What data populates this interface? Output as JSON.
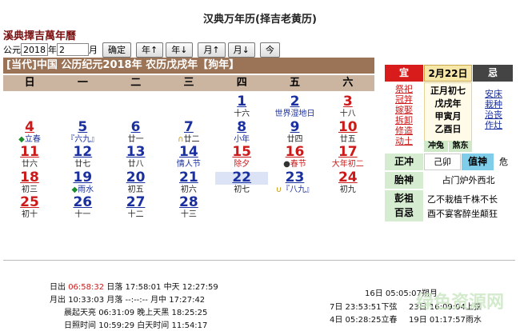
{
  "app_title": "汉典万年历(择吉老黄历)",
  "calendar_name": "溪典擇吉萬年曆",
  "controls": {
    "prefix": "公元",
    "year_value": "2018",
    "year_unit": "年",
    "month_value": "2",
    "month_unit": "月",
    "confirm": "确定",
    "year_up": "年↑",
    "year_down": "年↓",
    "month_up": "月↑",
    "month_down": "月↓",
    "today": "今"
  },
  "banner": {
    "era": "[当代]中国",
    "gregorian": "公历纪元2018年",
    "lunar": "农历戊戌年",
    "zodiac": "【狗年】"
  },
  "weekdays": [
    "日",
    "一",
    "二",
    "三",
    "四",
    "五",
    "六"
  ],
  "days": [
    {
      "day": "1",
      "sub": "十六",
      "col": 4,
      "row": 0,
      "dc": "blue",
      "sc": "dark",
      "mark": ""
    },
    {
      "day": "2",
      "sub": "世界湿地日",
      "col": 5,
      "row": 0,
      "dc": "blue",
      "sc": "blue",
      "mark": ""
    },
    {
      "day": "3",
      "sub": "十八",
      "col": 6,
      "row": 0,
      "dc": "red",
      "sc": "dark",
      "mark": ""
    },
    {
      "day": "4",
      "sub": "立春",
      "col": 0,
      "row": 1,
      "dc": "red",
      "sc": "blue",
      "mark": "◆"
    },
    {
      "day": "5",
      "sub": "『六九』",
      "col": 1,
      "row": 1,
      "dc": "blue",
      "sc": "blue",
      "mark": ""
    },
    {
      "day": "6",
      "sub": "廿一",
      "col": 2,
      "row": 1,
      "dc": "blue",
      "sc": "dark",
      "mark": ""
    },
    {
      "day": "7",
      "sub": "廿二",
      "col": 3,
      "row": 1,
      "dc": "blue",
      "sc": "dark",
      "mark": "∩"
    },
    {
      "day": "8",
      "sub": "小年",
      "col": 4,
      "row": 1,
      "dc": "blue",
      "sc": "blue",
      "mark": ""
    },
    {
      "day": "9",
      "sub": "廿四",
      "col": 5,
      "row": 1,
      "dc": "blue",
      "sc": "dark",
      "mark": ""
    },
    {
      "day": "10",
      "sub": "廿五",
      "col": 6,
      "row": 1,
      "dc": "red",
      "sc": "dark",
      "mark": ""
    },
    {
      "day": "11",
      "sub": "廿六",
      "col": 0,
      "row": 2,
      "dc": "red",
      "sc": "dark",
      "mark": ""
    },
    {
      "day": "12",
      "sub": "廿七",
      "col": 1,
      "row": 2,
      "dc": "blue",
      "sc": "dark",
      "mark": ""
    },
    {
      "day": "13",
      "sub": "廿八",
      "col": 2,
      "row": 2,
      "dc": "blue",
      "sc": "dark",
      "mark": ""
    },
    {
      "day": "14",
      "sub": "情人节",
      "col": 3,
      "row": 2,
      "dc": "blue",
      "sc": "blue",
      "mark": ""
    },
    {
      "day": "15",
      "sub": "除夕",
      "col": 4,
      "row": 2,
      "dc": "red",
      "sc": "red",
      "mark": ""
    },
    {
      "day": "16",
      "sub": "春节",
      "col": 5,
      "row": 2,
      "dc": "red",
      "sc": "red",
      "mark": "●"
    },
    {
      "day": "17",
      "sub": "大年初二",
      "col": 6,
      "row": 2,
      "dc": "red",
      "sc": "red",
      "mark": ""
    },
    {
      "day": "18",
      "sub": "初三",
      "col": 0,
      "row": 3,
      "dc": "red",
      "sc": "dark",
      "mark": ""
    },
    {
      "day": "19",
      "sub": "雨水",
      "col": 1,
      "row": 3,
      "dc": "blue",
      "sc": "blue",
      "mark": "◆"
    },
    {
      "day": "20",
      "sub": "初五",
      "col": 2,
      "row": 3,
      "dc": "blue",
      "sc": "dark",
      "mark": ""
    },
    {
      "day": "21",
      "sub": "初六",
      "col": 3,
      "row": 3,
      "dc": "blue",
      "sc": "dark",
      "mark": ""
    },
    {
      "day": "22",
      "sub": "初七",
      "col": 4,
      "row": 3,
      "dc": "blue",
      "sc": "dark",
      "mark": "",
      "today": true
    },
    {
      "day": "23",
      "sub": "『八九』",
      "col": 5,
      "row": 3,
      "dc": "blue",
      "sc": "blue",
      "mark": "∪"
    },
    {
      "day": "24",
      "sub": "初九",
      "col": 6,
      "row": 3,
      "dc": "red",
      "sc": "dark",
      "mark": ""
    },
    {
      "day": "25",
      "sub": "初十",
      "col": 0,
      "row": 4,
      "dc": "red",
      "sc": "dark",
      "mark": ""
    },
    {
      "day": "26",
      "sub": "十一",
      "col": 1,
      "row": 4,
      "dc": "blue",
      "sc": "dark",
      "mark": ""
    },
    {
      "day": "27",
      "sub": "十二",
      "col": 2,
      "row": 4,
      "dc": "blue",
      "sc": "dark",
      "mark": ""
    },
    {
      "day": "28",
      "sub": "十三",
      "col": 3,
      "row": 4,
      "dc": "blue",
      "sc": "dark",
      "mark": ""
    }
  ],
  "almanac": {
    "yi_label": "宜",
    "ji_label": "忌",
    "date_label": "2月22日",
    "yi_items": [
      "祭祀",
      "冠笄",
      "嫁娶",
      "拆卸",
      "修造",
      "动土"
    ],
    "ji_items": [
      "安床",
      "栽种",
      "治丧",
      "作灶"
    ],
    "lunar_lines": [
      "正月初七",
      "戊戌年",
      "甲寅月",
      "乙酉日"
    ],
    "chong": "冲兔",
    "sha": "煞东",
    "zhengchong_label": "正冲",
    "zhengchong_value": "己卯",
    "zhishen_label": "值神",
    "zhishen_value": "危",
    "taishen_label": "胎神",
    "taishen_value": "占门炉外西北",
    "pengzu_label_1": "彭祖",
    "pengzu_label_2": "百忌",
    "pengzu_line_1": "乙不栽植千株不长",
    "pengzu_line_2": "酉不宴客醉坐颠狂"
  },
  "sun_moon": {
    "sunrise_label": "日出",
    "sunrise": "06:58:32",
    "sunset_label": "日落",
    "sunset": "17:58:01",
    "noon_label": "中天",
    "noon": "12:27:59",
    "moonrise_label": "月出",
    "moonrise": "10:33:03",
    "moonset_label": "月落",
    "moonset": "--:--:--",
    "moon_noon_label": "月中",
    "moon_noon": "17:27:42",
    "dawn_label": "晨起天亮",
    "dawn": "06:31:09",
    "dusk_label": "晚上天黑",
    "dusk": "18:25:25",
    "daylight_label": "日照时间",
    "daylight": "10:59:29",
    "night_label": "白天时间",
    "night": "11:54:17"
  },
  "phases": {
    "row1": "16日 05:05:07朔月",
    "row2a": "7日 23:53:51下弦",
    "row2b": "23日 16:09:04上弦",
    "row3a": "4日 05:28:25立春",
    "row3b": "19日 01:17:57雨水"
  },
  "watermark": "绿色资源网",
  "colors": {
    "banner": "#9b7457",
    "weekhdr": "#cbb5a0",
    "blue": "#1a2fa0",
    "red": "#cc1a1a",
    "panel_green": "#cfe8c8",
    "panel_yellow": "#f7f0c8"
  }
}
